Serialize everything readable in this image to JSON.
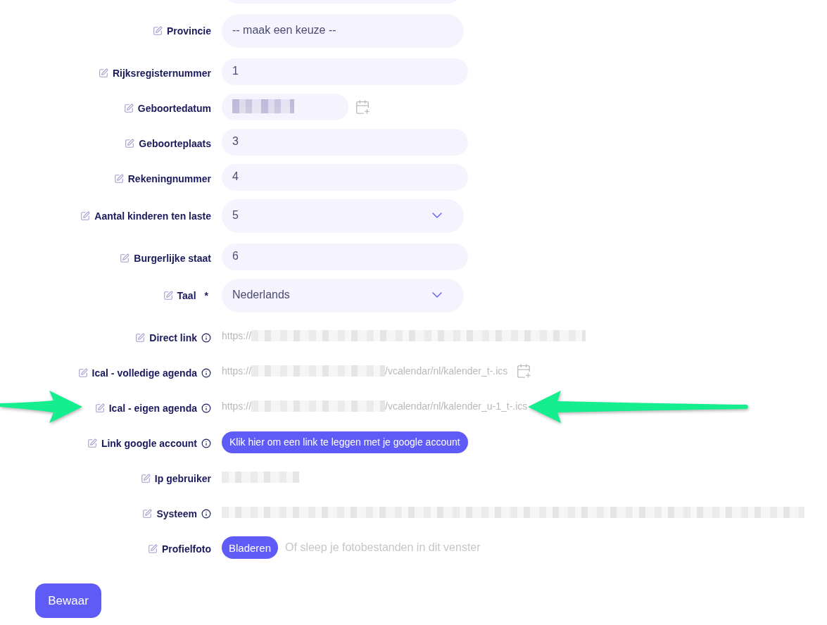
{
  "form": {
    "rows": [
      {
        "kind": "select",
        "marked": false
      },
      {
        "kind": "select",
        "label": "Provincie",
        "value": "-- maak een keuze --",
        "chevron": false,
        "info": false,
        "marked": false
      },
      {
        "kind": "input",
        "label": "Rijksregisternummer",
        "value": "1",
        "info": false,
        "marked": false
      },
      {
        "kind": "date",
        "label": "Geboortedatum",
        "redacted": true,
        "calendar": true,
        "info": false,
        "marked": false
      },
      {
        "kind": "input",
        "label": "Geboorteplaats",
        "value": "3",
        "info": false,
        "marked": false
      },
      {
        "kind": "input",
        "label": "Rekeningnummer",
        "value": "4",
        "info": false,
        "marked": false
      },
      {
        "kind": "select",
        "label": "Aantal kinderen ten laste",
        "value": "5",
        "chevron": true,
        "info": false,
        "marked": false
      },
      {
        "kind": "input",
        "label": "Burgerlijke staat",
        "value": "6",
        "info": false,
        "marked": false
      },
      {
        "kind": "select",
        "label": "Taal",
        "required_mark": "*",
        "value": "Nederlands",
        "chevron": true,
        "info": false,
        "marked": false
      },
      {
        "kind": "link",
        "label": "Direct link",
        "url_start": "https://",
        "redacted": true,
        "calendar": false,
        "info": true,
        "marked": false
      },
      {
        "kind": "link",
        "label": "Ical - volledige agenda",
        "url_start": "https://",
        "redacted": true,
        "url_end": "/vcalendar/nl/kalender_t-.ics",
        "calendar": true,
        "info": true,
        "marked": false
      },
      {
        "kind": "link",
        "label": "Ical - eigen agenda",
        "url_start": "https://",
        "redacted": true,
        "url_end": "/vcalendar/nl/kalender_u-1_t-.ics",
        "calendar": false,
        "info": true,
        "marked": true
      },
      {
        "kind": "action",
        "label": "Link google account",
        "button": "Klik hier om een link te leggen met je google account",
        "info": true,
        "marked": false
      },
      {
        "kind": "stamp",
        "label": "Ip gebruiker",
        "info": false,
        "marked": false
      },
      {
        "kind": "strip",
        "label": "Systeem",
        "info": true,
        "marked": false
      },
      {
        "kind": "file",
        "label": "Profielfoto",
        "button": "Bladeren",
        "hint": "Of sleep je fotobestanden in dit venster",
        "info": false,
        "marked": false
      }
    ]
  },
  "save_button": {
    "label": "Bewaar"
  }
}
